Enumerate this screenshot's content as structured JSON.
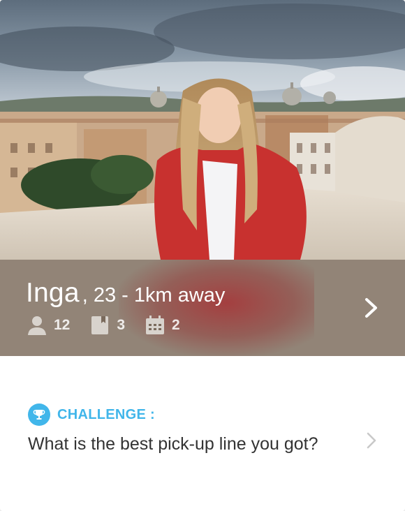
{
  "profile": {
    "name": "Inga",
    "meta": ", 23 - 1km away",
    "photo_icon": "profile-photo",
    "stats": [
      {
        "icon": "person-icon",
        "value": "12"
      },
      {
        "icon": "book-icon",
        "value": "3"
      },
      {
        "icon": "calendar-icon",
        "value": "2"
      }
    ],
    "open_icon": "chevron-right-icon"
  },
  "challenge": {
    "label": "CHALLENGE :",
    "text": "What is the best pick-up line you got?",
    "icon": "trophy-icon",
    "accent_color": "#41b6ea"
  }
}
